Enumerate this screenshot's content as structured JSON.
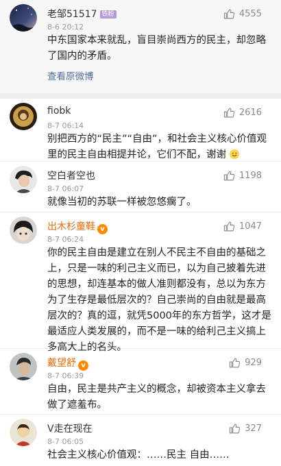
{
  "original_post": {
    "username": "老邹51517",
    "badge": "铁粉",
    "date": "8-6 20:12",
    "likes": "4555",
    "text": "中东国家本来就乱，盲目崇尚西方的民主，却忽略了国内的矛盾。",
    "view_link": "查看原微博"
  },
  "comments": [
    {
      "username": "fiobk",
      "date": "8-7 06:14",
      "likes": "2616",
      "text": "别把西方的“民主”“自由”，和社会主义核心价值观里的民主自由相提并论，它们不配，谢谢",
      "emoji": "smile-emoji"
    },
    {
      "username": "空白者空也",
      "date": "8-7 06:07",
      "likes": "1198",
      "text": "就像当初的苏联一样被忽悠瘸了。"
    },
    {
      "username": "出木杉童鞋",
      "vip": "v",
      "date": "8-7 06:24",
      "likes": "1047",
      "text": "你的民主自由是建立在别人不民主不自由的基础之上，只是一味的利己主义而已，以为自己披着先进的思想，却连基本的做人准则都没有，总以为东方为了生存是最低层次的？自己崇尚的自由就是最高层次的？真的逗，就凭5000年的东方哲学，这才是最适应人类发展的，而不是一味的给利己主义搞上多高大上的名头。"
    },
    {
      "username": "戴望舒",
      "vip": "v",
      "date": "8-7 06:39",
      "likes": "929",
      "text": "自由，民主是共产主义的概念，却被资本主义拿去做了遮羞布。"
    },
    {
      "username": "V走在现在",
      "date": "8-7 06:05",
      "likes": "327",
      "text": "社会主义核心价值观：……民主 自由……"
    }
  ],
  "colors": {
    "orange_username": "#e86b0a",
    "link": "#4f6f9a",
    "origin_bg": "#f7f7f7"
  }
}
